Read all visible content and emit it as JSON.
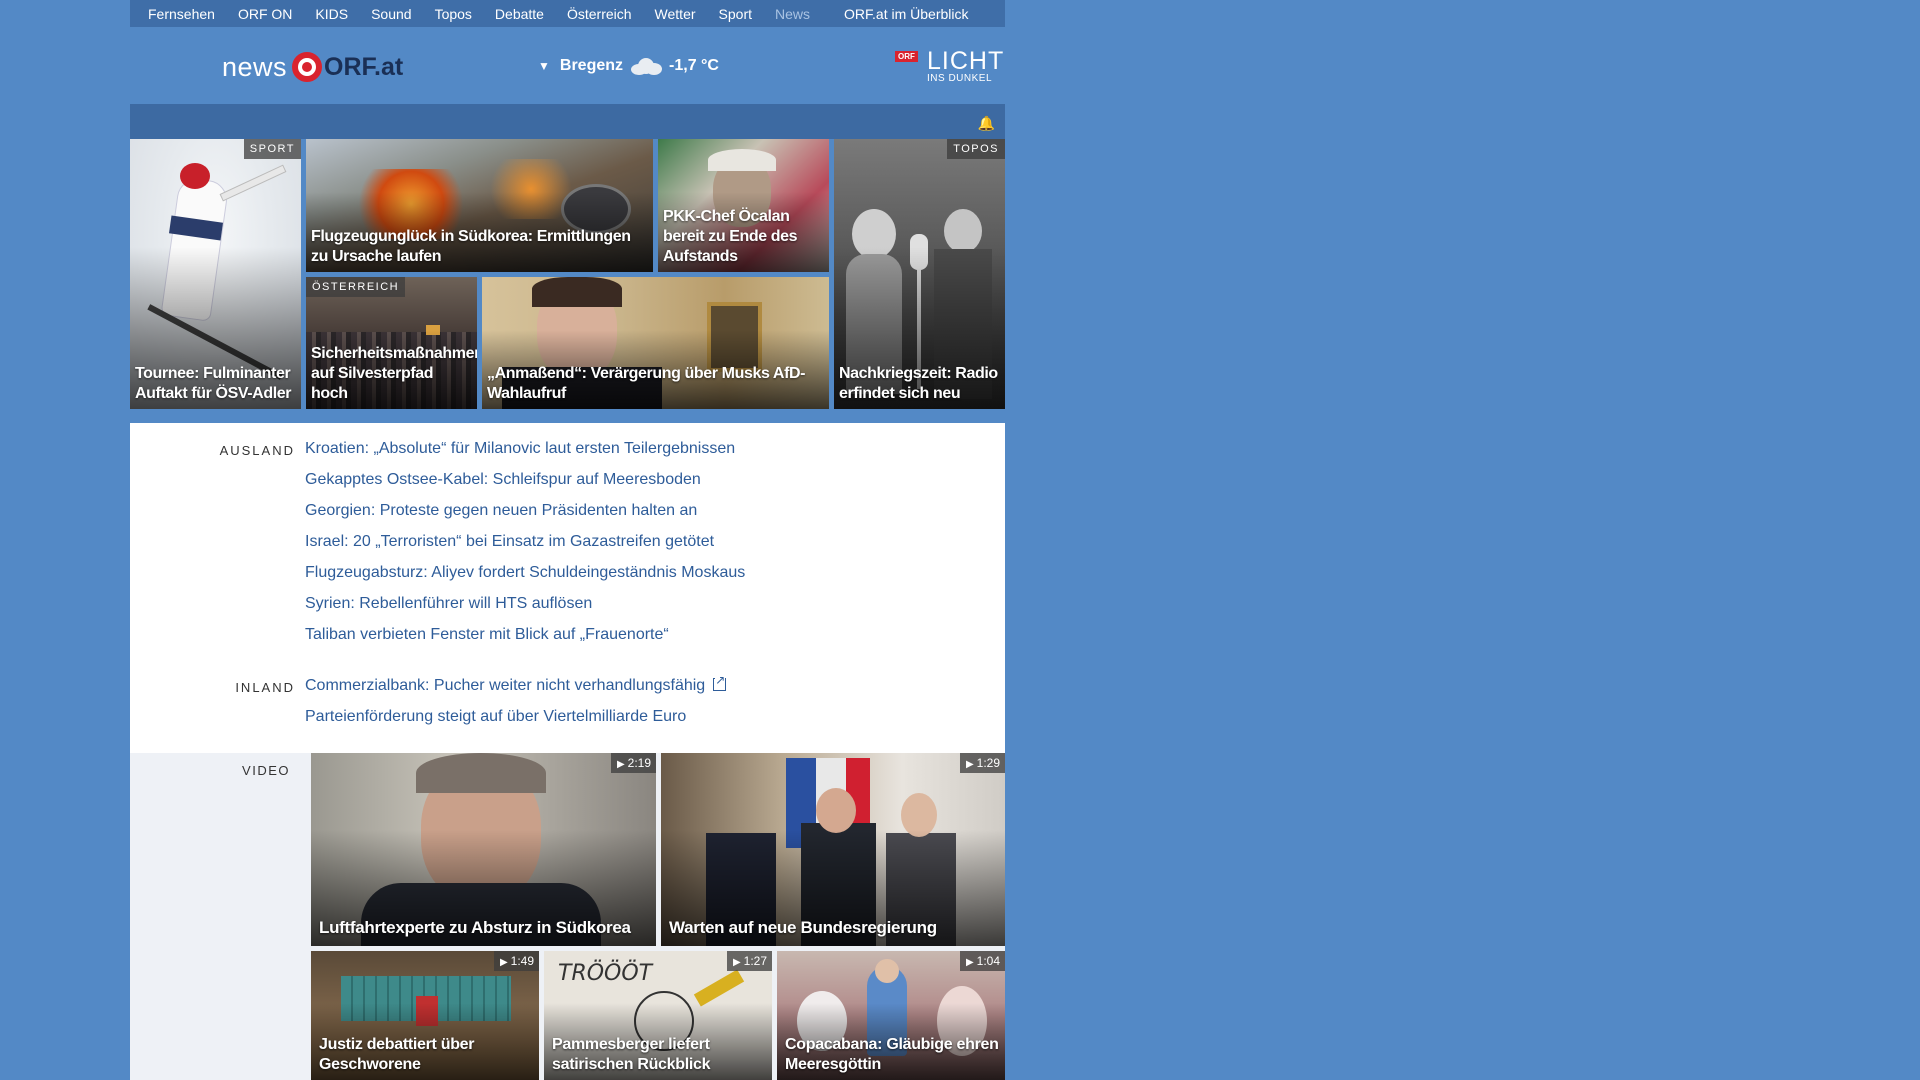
{
  "topnav": {
    "items": [
      "Fernsehen",
      "ORF ON",
      "KIDS",
      "Sound",
      "Topos",
      "Debatte",
      "Österreich",
      "Wetter",
      "Sport",
      "News"
    ],
    "overview": "ORF.at im Überblick"
  },
  "header": {
    "logo_news": "news",
    "logo_orf": "ORF.at",
    "weather_city": "Bregenz",
    "weather_temp": "-1,7 °C",
    "lid_orf": "ORF",
    "lid_licht": "LICHT",
    "lid_dunkel": "INS DUNKEL"
  },
  "teasers": [
    {
      "tag": "SPORT",
      "caption": "Tournee: Fulminanter Auftakt für ÖSV-Adler"
    },
    {
      "tag": "",
      "caption": "Flugzeugunglück in Südkorea: Ermittlungen zu Ursache laufen"
    },
    {
      "tag": "",
      "caption": "PKK-Chef Öcalan bereit zu Ende des Aufstands"
    },
    {
      "tag": "TOPOS",
      "caption": "Nachkriegszeit: Radio erfindet sich neu"
    },
    {
      "tag": "ÖSTERREICH",
      "caption": "Sicherheitsmaßnahmen auf Silvesterpfad hoch"
    },
    {
      "tag": "",
      "caption": "„Anmaßend“: Verärgerung über Musks AfD-Wahlaufruf"
    }
  ],
  "ausland": {
    "label": "AUSLAND",
    "links": [
      "Kroatien: „Absolute“ für Milanovic laut ersten Teilergebnissen",
      "Gekapptes Ostsee-Kabel: Schleifspur auf Meeresboden",
      "Georgien: Proteste gegen neuen Präsidenten halten an",
      "Israel: 20 „Terroristen“ bei Einsatz im Gazastreifen getötet",
      "Flugzeugabsturz: Aliyev fordert Schuldeingeständnis Moskaus",
      "Syrien: Rebellenführer will HTS auflösen",
      "Taliban verbieten Fenster mit Blick auf „Frauenorte“"
    ]
  },
  "inland": {
    "label": "INLAND",
    "links": [
      "Commerzialbank: Pucher weiter nicht verhandlungsfähig",
      "Parteienförderung steigt auf über Viertelmilliarde Euro"
    ]
  },
  "video": {
    "label": "VIDEO",
    "items": [
      {
        "duration": "2:19",
        "caption": "Luftfahrtexperte zu Absturz in Südkorea"
      },
      {
        "duration": "1:29",
        "caption": "Warten auf neue Bundesregierung"
      },
      {
        "duration": "1:49",
        "caption": "Justiz debattiert über Geschworene"
      },
      {
        "duration": "1:27",
        "caption": "Pammesberger liefert satirischen Rückblick"
      },
      {
        "duration": "1:04",
        "caption": "Copacabana: Gläubige ehren Meeresgöttin"
      }
    ]
  },
  "colors": {
    "brand_red": "#d9232e",
    "page_blue": "#5389c6",
    "link_blue": "#2e5c99"
  }
}
